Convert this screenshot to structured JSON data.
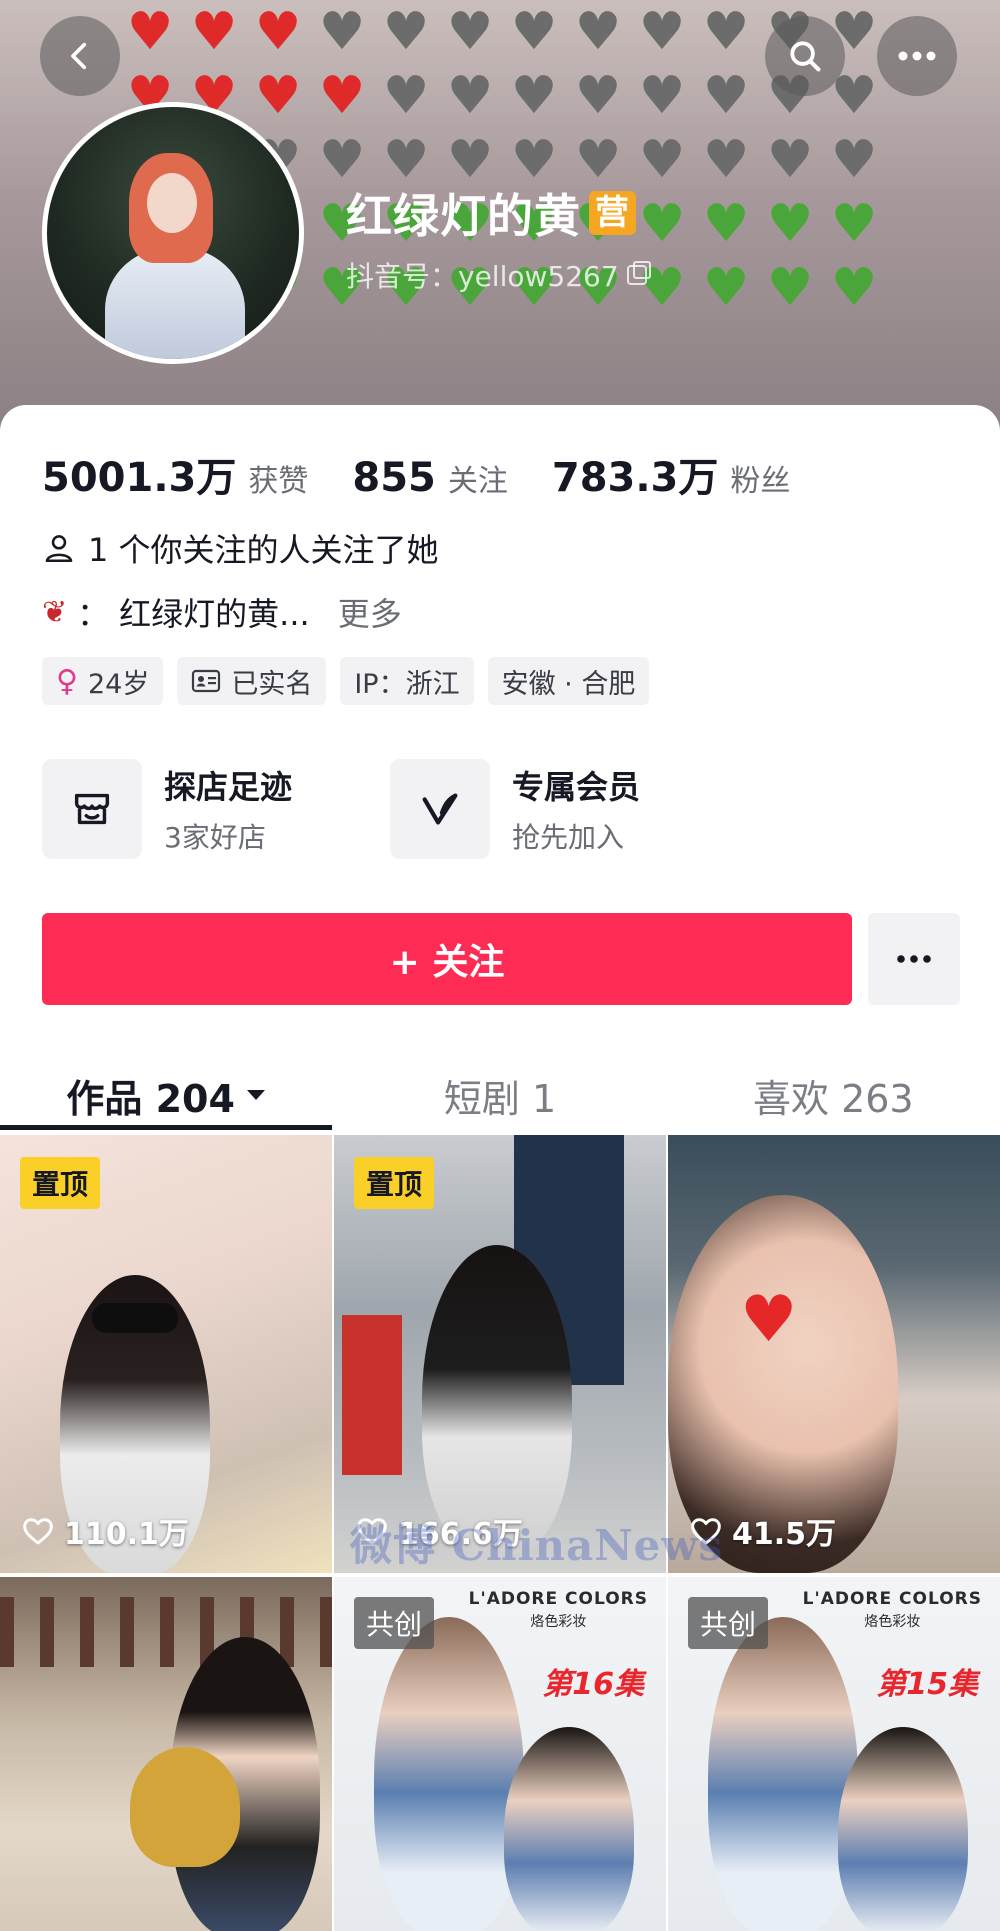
{
  "header": {
    "emoji_rows": [
      [
        "red",
        "red",
        "red",
        "broken",
        "broken",
        "broken",
        "broken",
        "broken",
        "broken",
        "broken",
        "broken",
        "broken"
      ],
      [
        "red",
        "red",
        "red",
        "red",
        "broken",
        "broken",
        "broken",
        "broken",
        "broken",
        "broken",
        "broken",
        "broken"
      ],
      [
        "red",
        "red",
        "broken",
        "broken",
        "broken",
        "broken",
        "broken",
        "broken",
        "broken",
        "broken",
        "broken",
        "broken"
      ],
      [
        "green",
        "green",
        "green",
        "green",
        "green",
        "green",
        "green",
        "green",
        "green",
        "green",
        "green",
        "green"
      ],
      [
        "green",
        "green",
        "green",
        "green",
        "green",
        "green",
        "green",
        "green",
        "green",
        "green",
        "green",
        "green"
      ]
    ],
    "back_icon": "chevron-left-icon",
    "search_icon": "search-icon",
    "more_icon": "more-horizontal-icon"
  },
  "profile": {
    "name": "红绿灯的黄",
    "badge": "营",
    "douyin_id": "抖音号：yellow5267"
  },
  "stats": [
    {
      "value": "5001.3万",
      "label": "获赞"
    },
    {
      "value": "855",
      "label": "关注"
    },
    {
      "value": "783.3万",
      "label": "粉丝"
    }
  ],
  "mutual_text": "1 个你关注的人关注了她",
  "bio": {
    "prefix": "：",
    "text": "红绿灯的黄...",
    "more": "更多"
  },
  "tags": [
    {
      "icon": "female-icon",
      "text": "24岁"
    },
    {
      "icon": "id-card-icon",
      "text": "已实名"
    },
    {
      "icon": "",
      "text": "IP：浙江"
    },
    {
      "icon": "",
      "text": "安徽 · 合肥"
    }
  ],
  "features": [
    {
      "icon": "store-icon",
      "title": "探店足迹",
      "subtitle": "3家好店"
    },
    {
      "icon": "v-icon",
      "title": "专属会员",
      "subtitle": "抢先加入"
    }
  ],
  "follow_button": "+ 关注",
  "tabs": [
    {
      "label": "作品 204",
      "dropdown": true
    },
    {
      "label": "短剧 1",
      "dropdown": false
    },
    {
      "label": "喜欢 263",
      "dropdown": false
    }
  ],
  "videos": [
    {
      "badge": "置顶",
      "likes": "110.1万"
    },
    {
      "badge": "置顶",
      "likes": "166.6万"
    },
    {
      "badge": "",
      "likes": "41.5万"
    },
    {
      "badge": "",
      "likes": ""
    },
    {
      "badge": "共创",
      "likes": "",
      "brand": "L'ADORE COLORS",
      "brand_sub": "烙色彩妆",
      "episode": "第16集"
    },
    {
      "badge": "共创",
      "likes": "",
      "brand": "L'ADORE COLORS",
      "brand_sub": "烙色彩妆",
      "episode": "第15集"
    }
  ],
  "watermark": "微博 ChinaNews",
  "colors": {
    "accent": "#fe2c55",
    "pin": "#facf28"
  }
}
